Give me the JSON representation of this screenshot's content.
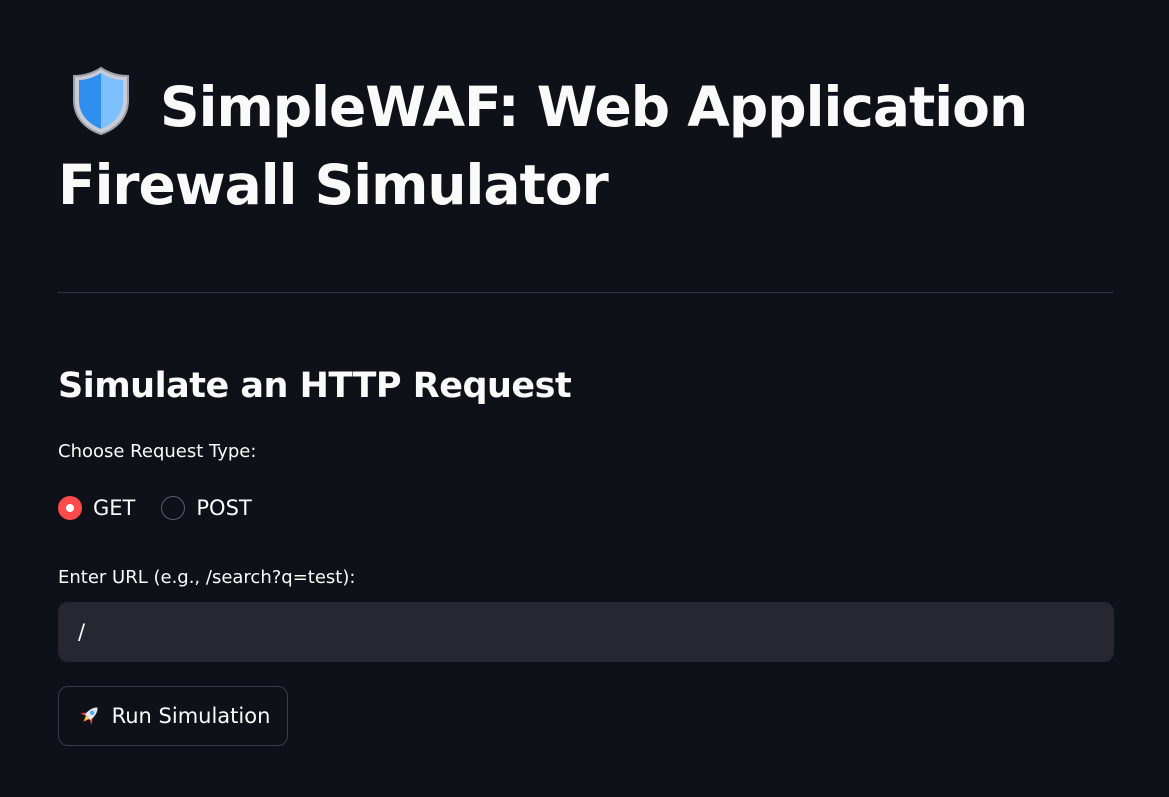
{
  "header": {
    "title": "SimpleWAF: Web Application Firewall Simulator",
    "title_icon": "shield-icon"
  },
  "section": {
    "subheader": "Simulate an HTTP Request"
  },
  "request_type": {
    "label": "Choose Request Type:",
    "options": [
      {
        "label": "GET",
        "selected": true
      },
      {
        "label": "POST",
        "selected": false
      }
    ]
  },
  "url_input": {
    "label": "Enter URL (e.g., /search?q=test):",
    "value": "/"
  },
  "run_button": {
    "icon": "rocket-icon",
    "label": "Run Simulation"
  },
  "colors": {
    "background": "#0e1117",
    "text": "#fafafa",
    "accent": "#ff4b4b",
    "input_background": "#262730",
    "divider": "#31333f"
  }
}
